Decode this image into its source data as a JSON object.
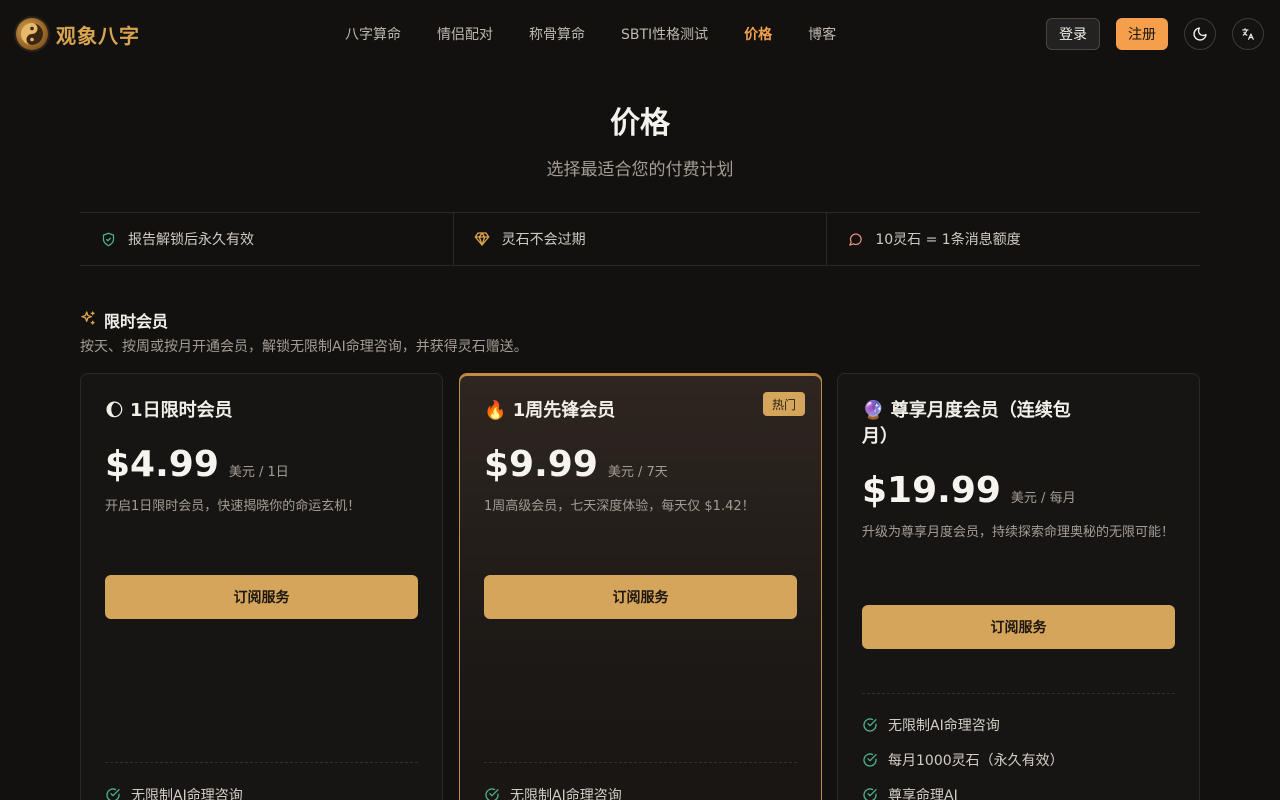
{
  "header": {
    "logo_text": "观象八字",
    "nav": [
      {
        "label": "八字算命",
        "active": false
      },
      {
        "label": "情侣配对",
        "active": false
      },
      {
        "label": "称骨算命",
        "active": false
      },
      {
        "label": "SBTI性格测试",
        "active": false
      },
      {
        "label": "价格",
        "active": true
      },
      {
        "label": "博客",
        "active": false
      }
    ],
    "login_label": "登录",
    "register_label": "注册",
    "theme_icon": "moon-icon",
    "language_icon": "translate-icon"
  },
  "hero": {
    "title": "价格",
    "subtitle": "选择最适合您的付费计划"
  },
  "features": [
    {
      "icon": "shield-check-icon",
      "label": "报告解锁后永久有效"
    },
    {
      "icon": "diamond-icon",
      "label": "灵石不会过期"
    },
    {
      "icon": "message-icon",
      "label": "10灵石 = 1条消息额度"
    }
  ],
  "section": {
    "title": "限时会员",
    "description": "按天、按周或按月开通会员，解锁无限制AI命理咨询，并获得灵石赠送。"
  },
  "plans": [
    {
      "emoji": "🌔",
      "title": "1日限时会员",
      "price": "$4.99",
      "unit": "美元 / 1日",
      "description": "开启1日限时会员，快速揭晓你的命运玄机！",
      "button": "订阅服务",
      "perks": [
        "无限制AI命理咨询"
      ]
    },
    {
      "emoji": "🔥",
      "title": "1周先锋会员",
      "badge": "热门",
      "price": "$9.99",
      "unit": "美元 / 7天",
      "description": "1周高级会员，七天深度体验，每天仅 $1.42！",
      "button": "订阅服务",
      "perks": [
        "无限制AI命理咨询"
      ]
    },
    {
      "emoji": "🔮",
      "title": "尊享月度会员（连续包月）",
      "price": "$19.99",
      "unit": "美元 / 每月",
      "description": "升级为尊享月度会员，持续探索命理奥秘的无限可能！",
      "button": "订阅服务",
      "perks": [
        "无限制AI命理咨询",
        "每月1000灵石（永久有效）",
        "尊享命理AI"
      ]
    }
  ],
  "colors": {
    "accent": "#f59e4b",
    "gold": "#d4a55a",
    "background": "#121110",
    "check": "#4caf8a"
  }
}
